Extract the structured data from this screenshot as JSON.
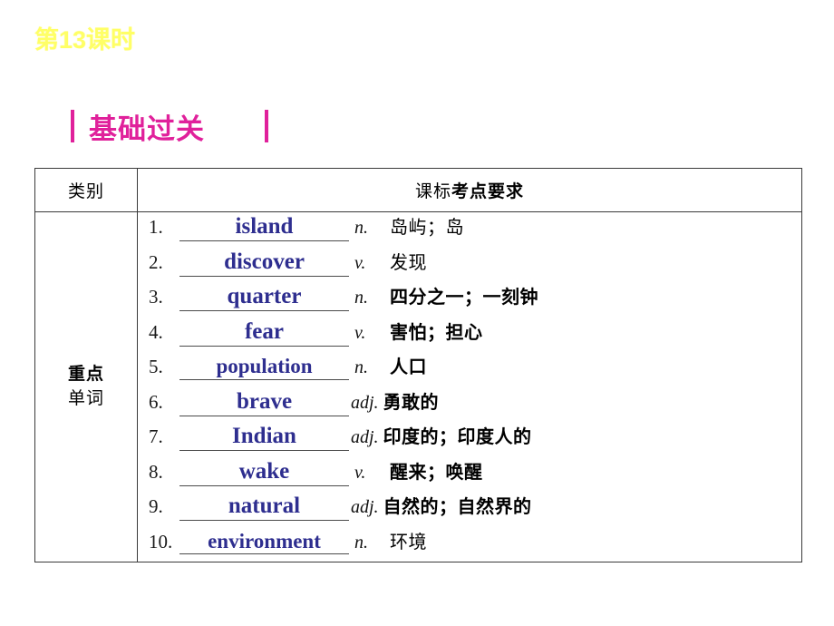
{
  "lesson": {
    "title": "第13课时"
  },
  "section": {
    "heading": "基础过关",
    "bar_color": "#e0219b",
    "title_color": "#ffff66"
  },
  "table": {
    "headers": {
      "category": "类别",
      "requirement_prefix": "课标",
      "requirement_strong": "考点要求"
    },
    "category_label": {
      "line1": "重点",
      "line2": "单词"
    },
    "word_color": "#2e2e8f",
    "rows": [
      {
        "index": "1.",
        "word": "island",
        "pos": "n.",
        "meaning": "岛屿；岛",
        "meaning_weight": "reg"
      },
      {
        "index": "2.",
        "word": "discover",
        "pos": "v.",
        "meaning": "发现",
        "meaning_weight": "reg"
      },
      {
        "index": "3.",
        "word": "quarter",
        "pos": "n.",
        "meaning": "四分之一；一刻钟",
        "meaning_weight": "bold"
      },
      {
        "index": "4.",
        "word": "fear",
        "pos": "v.",
        "meaning": "害怕；担心",
        "meaning_weight": "bold"
      },
      {
        "index": "5.",
        "word": "population",
        "pos": "n.",
        "meaning": "人口",
        "meaning_weight": "bold"
      },
      {
        "index": "6.",
        "word": "brave",
        "pos": "adj.",
        "meaning": "勇敢的",
        "meaning_weight": "bold"
      },
      {
        "index": "7.",
        "word": "Indian",
        "pos": "adj.",
        "meaning": "印度的；印度人的",
        "meaning_weight": "bold"
      },
      {
        "index": "8.",
        "word": "wake",
        "pos": "v.",
        "meaning": "醒来；唤醒",
        "meaning_weight": "bold"
      },
      {
        "index": "9.",
        "word": "natural",
        "pos": "adj.",
        "meaning": "自然的；自然界的",
        "meaning_weight": "bold"
      },
      {
        "index": "10.",
        "word": "environment",
        "pos": "n.",
        "meaning": "环境",
        "meaning_weight": "reg"
      }
    ]
  }
}
